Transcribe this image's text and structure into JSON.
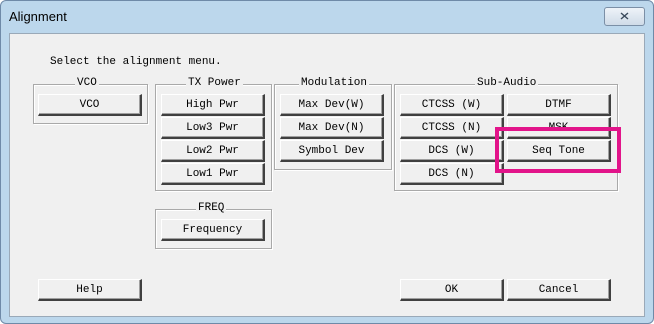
{
  "window": {
    "title": "Alignment",
    "close_icon": "close-x-icon"
  },
  "prompt": "Select the alignment menu.",
  "groups": {
    "vco": {
      "label": "VCO",
      "buttons": [
        "VCO"
      ]
    },
    "tx_power": {
      "label": "TX Power",
      "buttons": [
        "High Pwr",
        "Low3 Pwr",
        "Low2 Pwr",
        "Low1 Pwr"
      ]
    },
    "modulation": {
      "label": "Modulation",
      "buttons": [
        "Max Dev(W)",
        "Max Dev(N)",
        "Symbol Dev"
      ]
    },
    "sub_audio": {
      "label": "Sub-Audio",
      "buttons": [
        "CTCSS (W)",
        "CTCSS (N)",
        "DCS (W)",
        "DCS (N)",
        "DTMF",
        "MSK",
        "Seq Tone"
      ]
    },
    "freq": {
      "label": "FREQ",
      "buttons": [
        "Frequency"
      ]
    }
  },
  "footer": {
    "help": "Help",
    "ok": "OK",
    "cancel": "Cancel"
  },
  "colors": {
    "highlight": "#e2148a",
    "window_frame": "#bcd7ec"
  }
}
